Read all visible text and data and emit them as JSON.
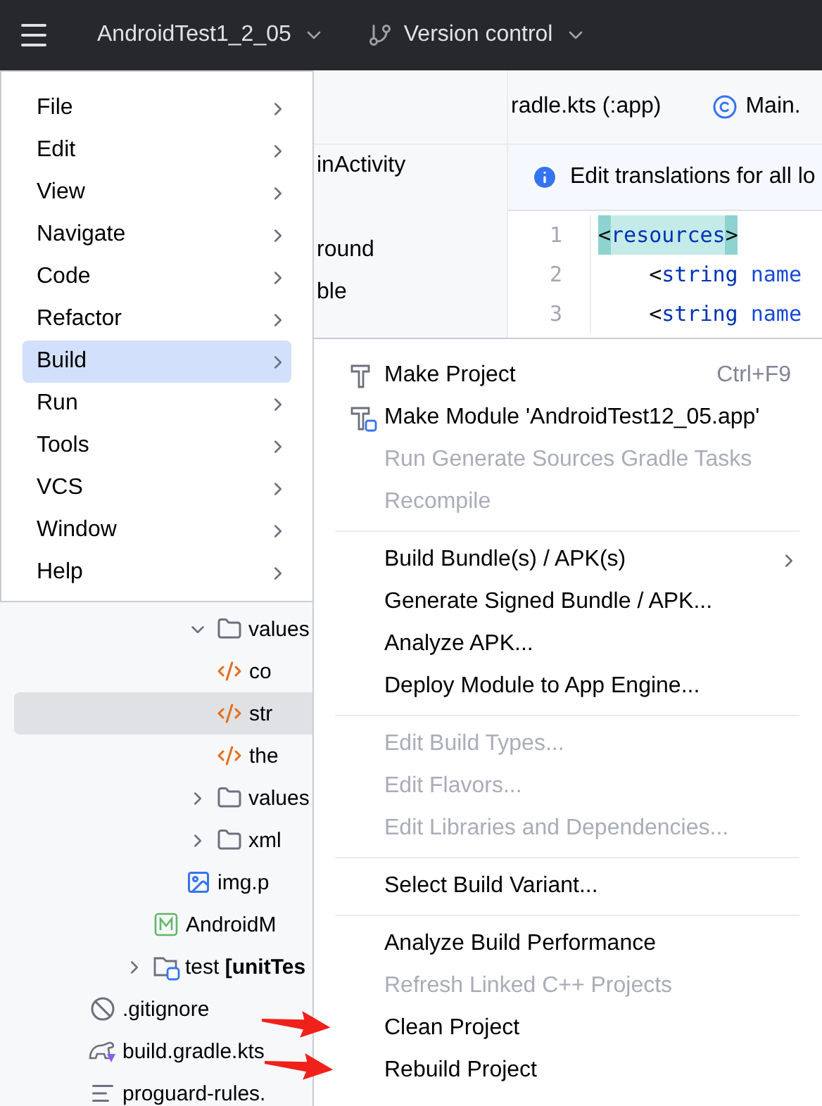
{
  "top_bar": {
    "project": "AndroidTest1_2_05",
    "vcs": "Version control"
  },
  "main_menu": [
    {
      "label": "File",
      "selected": false
    },
    {
      "label": "Edit",
      "selected": false
    },
    {
      "label": "View",
      "selected": false
    },
    {
      "label": "Navigate",
      "selected": false
    },
    {
      "label": "Code",
      "selected": false
    },
    {
      "label": "Refactor",
      "selected": false
    },
    {
      "label": "Build",
      "selected": true
    },
    {
      "label": "Run",
      "selected": false
    },
    {
      "label": "Tools",
      "selected": false
    },
    {
      "label": "VCS",
      "selected": false
    },
    {
      "label": "Window",
      "selected": false
    },
    {
      "label": "Help",
      "selected": false
    }
  ],
  "build_menu": [
    {
      "kind": "tool",
      "label": "Make Project",
      "shortcut": "Ctrl+F9",
      "disabled": false
    },
    {
      "kind": "module",
      "label": "Make Module 'AndroidTest12_05.app'",
      "disabled": false
    },
    {
      "kind": "item",
      "label": "Run Generate Sources Gradle Tasks",
      "disabled": true
    },
    {
      "kind": "item",
      "label": "Recompile",
      "disabled": true
    },
    {
      "kind": "separator"
    },
    {
      "kind": "item",
      "label": "Build Bundle(s) / APK(s)",
      "disabled": false,
      "submenu": true
    },
    {
      "kind": "item",
      "label": "Generate Signed Bundle / APK...",
      "disabled": false
    },
    {
      "kind": "item",
      "label": "Analyze APK...",
      "disabled": false
    },
    {
      "kind": "item",
      "label": "Deploy Module to App Engine...",
      "disabled": false
    },
    {
      "kind": "separator"
    },
    {
      "kind": "item",
      "label": "Edit Build Types...",
      "disabled": true
    },
    {
      "kind": "item",
      "label": "Edit Flavors...",
      "disabled": true
    },
    {
      "kind": "item",
      "label": "Edit Libraries and Dependencies...",
      "disabled": true
    },
    {
      "kind": "separator"
    },
    {
      "kind": "item",
      "label": "Select Build Variant...",
      "disabled": false
    },
    {
      "kind": "separator"
    },
    {
      "kind": "item",
      "label": "Analyze Build Performance",
      "disabled": false
    },
    {
      "kind": "item",
      "label": "Refresh Linked C++ Projects",
      "disabled": true
    },
    {
      "kind": "item",
      "label": "Clean Project",
      "disabled": false
    },
    {
      "kind": "item",
      "label": "Rebuild Project",
      "disabled": false
    }
  ],
  "tree_fragments": [
    {
      "kind": "text",
      "label": "inActivity"
    },
    {
      "kind": "gap"
    },
    {
      "kind": "text",
      "label": "round"
    },
    {
      "kind": "text",
      "label": "ble"
    }
  ],
  "tree": [
    {
      "children": [
        {
          "children": [
            {
              "children": [
                {
                  "kind": "folder",
                  "label": "values",
                  "expanded": true,
                  "children": [
                    {
                      "kind": "xml",
                      "label": "co",
                      "selected": false
                    },
                    {
                      "kind": "xml",
                      "label": "str",
                      "selected": true
                    },
                    {
                      "kind": "xml",
                      "label": "the",
                      "selected": false
                    }
                  ]
                },
                {
                  "kind": "folder",
                  "label": "values",
                  "expanded": false
                },
                {
                  "kind": "folder",
                  "label": "xml",
                  "expanded": false
                },
                {
                  "kind": "image",
                  "label": "img.p",
                  "selected": false
                }
              ]
            },
            {
              "kind": "manifest",
              "label": "AndroidM",
              "selected": false
            }
          ]
        },
        {
          "kind": "test-folder",
          "label": "test **[unitTes**",
          "expanded": false
        }
      ]
    },
    {
      "kind": "ignore",
      "label": ".gitignore",
      "selected": false
    },
    {
      "kind": "gradle",
      "label": "build.gradle.kts",
      "selected": false
    },
    {
      "kind": "text",
      "label": "proguard-rules.",
      "selected": false
    }
  ],
  "editor": {
    "tabs": [
      {
        "kind": "plain",
        "label": "radle.kts (:app)"
      },
      {
        "kind": "class",
        "label": "Main."
      }
    ],
    "banner": "Edit translations for all lo",
    "lines": [
      {
        "number": "1",
        "highlighted": true,
        "tokens": [
          {
            "kind": "punct",
            "text": "<"
          },
          {
            "kind": "tag",
            "text": "resources"
          },
          {
            "kind": "punct",
            "text": ">"
          }
        ]
      },
      {
        "number": "2",
        "highlighted": false,
        "tokens": [
          {
            "kind": "punct",
            "text": "    <"
          },
          {
            "kind": "tag",
            "text": "string"
          },
          {
            "kind": "attr",
            "text": " name"
          }
        ]
      },
      {
        "number": "3",
        "highlighted": false,
        "tokens": [
          {
            "kind": "punct",
            "text": "    <"
          },
          {
            "kind": "tag",
            "text": "string"
          },
          {
            "kind": "attr",
            "text": " name"
          }
        ]
      }
    ]
  }
}
